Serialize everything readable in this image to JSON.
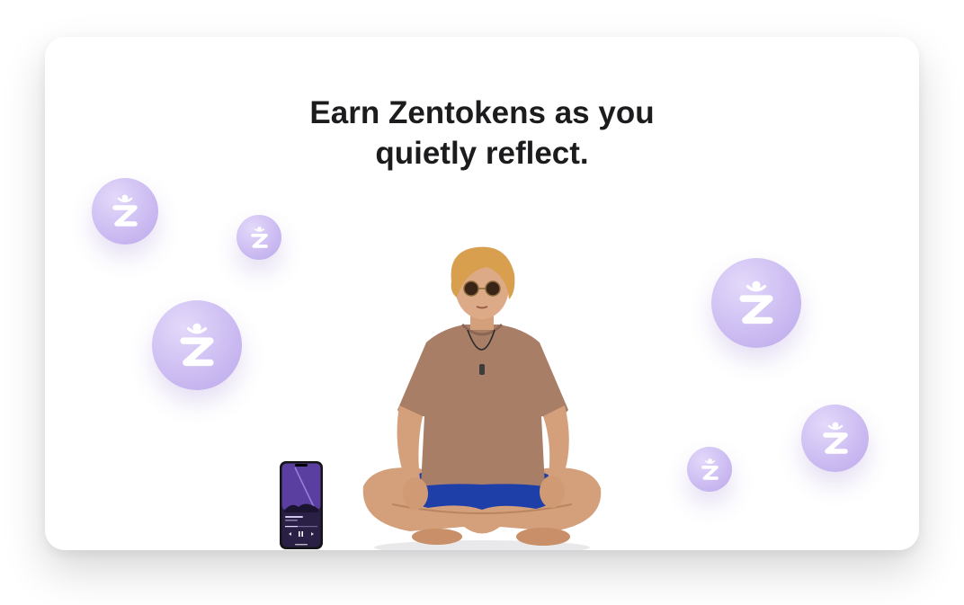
{
  "headline": {
    "line1": "Earn Zentokens as you",
    "line2": "quietly reflect."
  },
  "tokens": [
    {
      "icon": "zentoken-icon"
    },
    {
      "icon": "zentoken-icon"
    },
    {
      "icon": "zentoken-icon"
    },
    {
      "icon": "zentoken-icon"
    },
    {
      "icon": "zentoken-icon"
    },
    {
      "icon": "zentoken-icon"
    }
  ],
  "colors": {
    "token_fill": "#cdbdf2",
    "token_glyph": "#ffffff",
    "headline": "#1c1c1e",
    "phone_screen": "#5b3fa0"
  }
}
